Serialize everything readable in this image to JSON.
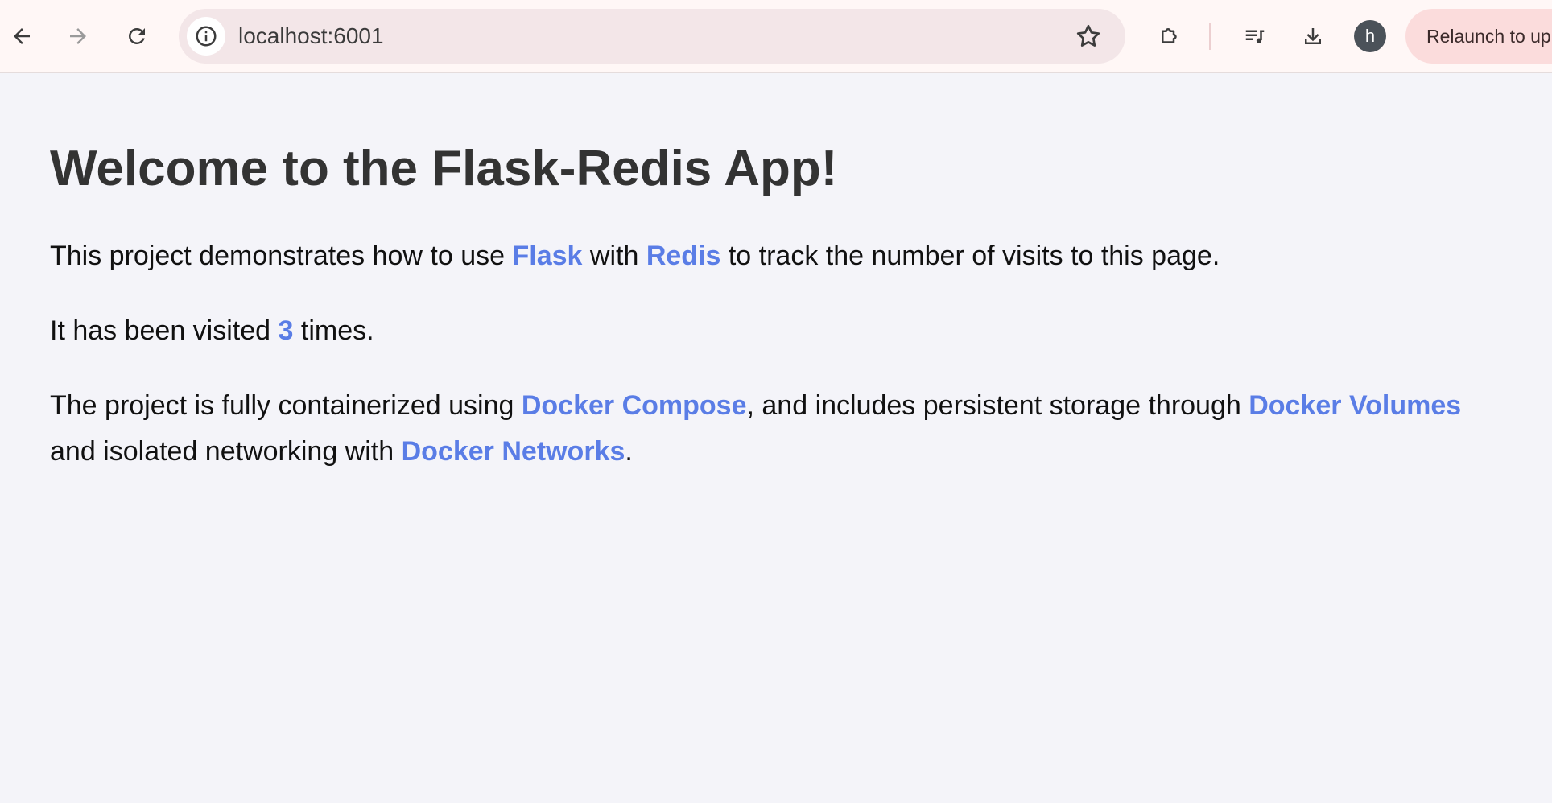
{
  "browser": {
    "url": "localhost:6001",
    "profile_initial": "h",
    "relaunch_label": "Relaunch to up",
    "icons": [
      "back-icon",
      "forward-icon",
      "reload-icon",
      "site-info-icon",
      "bookmark-star-icon",
      "extensions-icon",
      "media-control-icon",
      "download-icon"
    ]
  },
  "page": {
    "heading": "Welcome to the Flask-Redis App!",
    "p1": {
      "t1": "This project demonstrates how to use ",
      "flask": "Flask",
      "t2": " with ",
      "redis": "Redis",
      "t3": " to track the number of visits to this page."
    },
    "p2": {
      "t1": "It has been visited ",
      "count": "3",
      "t2": " times."
    },
    "p3": {
      "t1": "The project is fully containerized using ",
      "compose": "Docker Compose",
      "t2": ", and includes persistent storage through ",
      "volumes": "Docker Volumes",
      "t3": "and isolated networking with ",
      "networks": "Docker Networks",
      "t4": "."
    }
  },
  "colors": {
    "accent": "#5a7de6",
    "page_bg": "#f4f4f9",
    "toolbar_bg": "#fff7f6",
    "heading": "#333333"
  }
}
